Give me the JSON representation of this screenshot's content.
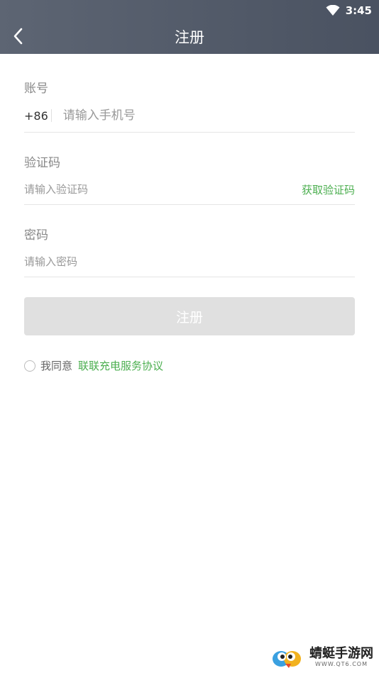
{
  "status_bar": {
    "time": "3:45",
    "wifi_icon": "wifi-icon"
  },
  "header": {
    "title": "注册",
    "back_icon": "chevron-left-icon"
  },
  "form": {
    "account": {
      "label": "账号",
      "prefix": "+86",
      "placeholder": "请输入手机号",
      "value": ""
    },
    "code": {
      "label": "验证码",
      "placeholder": "请输入验证码",
      "value": "",
      "action": "获取验证码"
    },
    "password": {
      "label": "密码",
      "placeholder": "请输入密码",
      "value": ""
    },
    "submit_label": "注册"
  },
  "agreement": {
    "text": "我同意",
    "link": "联联充电服务协议",
    "checked": false
  },
  "watermark": {
    "name": "蜻蜓手游网",
    "url": "WWW.QT6.COM"
  },
  "colors": {
    "header_bg": "#535b68",
    "accent": "#4caf50",
    "button_disabled": "#e0e0e0"
  }
}
